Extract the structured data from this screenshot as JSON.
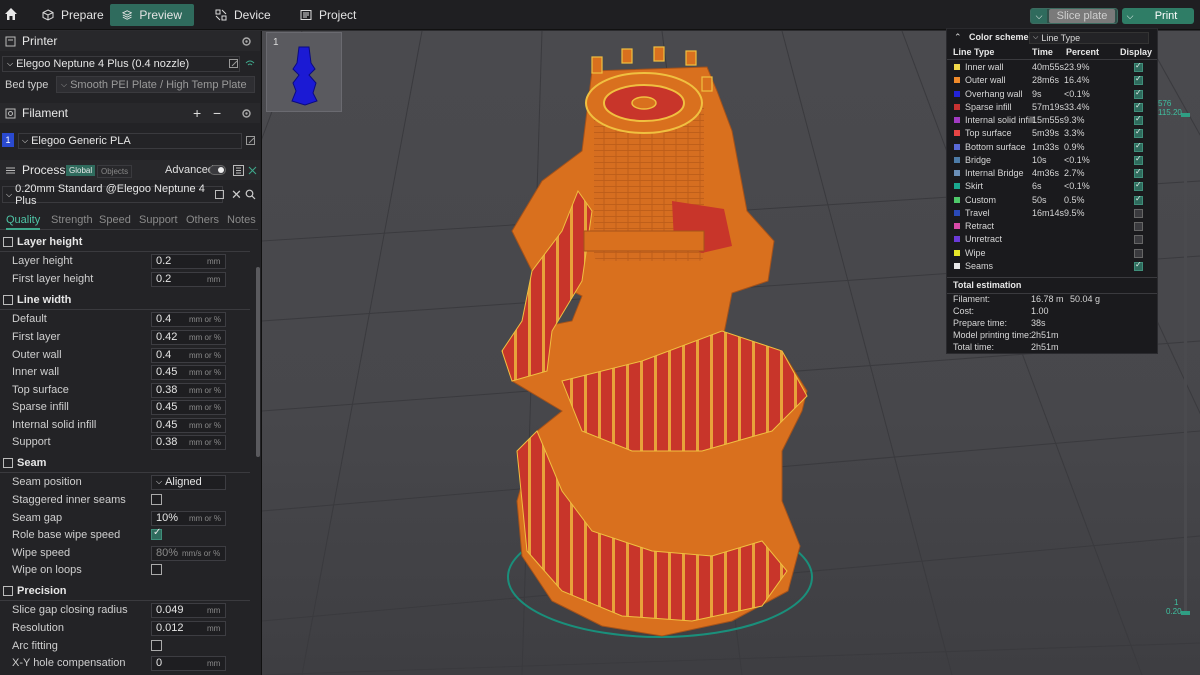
{
  "toolbar": {
    "prepare": "Prepare",
    "preview": "Preview",
    "device": "Device",
    "project": "Project",
    "slice_plate": "Slice plate",
    "print": "Print"
  },
  "printer": {
    "title": "Printer",
    "name": "Elegoo Neptune 4 Plus (0.4 nozzle)",
    "bed_type_label": "Bed type",
    "bed_type": "Smooth PEI Plate / High Temp Plate"
  },
  "filament": {
    "title": "Filament",
    "index": "1",
    "name": "Elegoo Generic PLA"
  },
  "process": {
    "title": "Process",
    "global": "Global",
    "objects": "Objects",
    "advanced": "Advanced",
    "preset": "0.20mm Standard @Elegoo Neptune 4 Plus",
    "tabs": [
      "Quality",
      "Strength",
      "Speed",
      "Support",
      "Others",
      "Notes"
    ]
  },
  "layer_height": {
    "title": "Layer height",
    "layer_height_label": "Layer height",
    "layer_height": "0.2",
    "unit": "mm",
    "first_label": "First layer height",
    "first": "0.2"
  },
  "line_width": {
    "title": "Line width",
    "unit": "mm or %",
    "items": [
      {
        "label": "Default",
        "value": "0.4"
      },
      {
        "label": "First layer",
        "value": "0.42"
      },
      {
        "label": "Outer wall",
        "value": "0.4"
      },
      {
        "label": "Inner wall",
        "value": "0.45"
      },
      {
        "label": "Top surface",
        "value": "0.38"
      },
      {
        "label": "Sparse infill",
        "value": "0.45"
      },
      {
        "label": "Internal solid infill",
        "value": "0.45"
      },
      {
        "label": "Support",
        "value": "0.38"
      }
    ]
  },
  "seam": {
    "title": "Seam",
    "position_label": "Seam position",
    "position": "Aligned",
    "staggered_label": "Staggered inner seams",
    "gap_label": "Seam gap",
    "gap": "10%",
    "gap_unit": "mm or %",
    "role_label": "Role base wipe speed",
    "wipe_speed_label": "Wipe speed",
    "wipe_speed": "80%",
    "wipe_unit": "mm/s or %",
    "wipe_loops_label": "Wipe on loops"
  },
  "precision": {
    "title": "Precision",
    "closing_label": "Slice gap closing radius",
    "closing": "0.049",
    "resolution_label": "Resolution",
    "resolution": "0.012",
    "arc_label": "Arc fitting",
    "xy_label": "X-Y hole compensation",
    "xy": "0",
    "unit": "mm"
  },
  "plate_thumb": {
    "index": "1"
  },
  "legend": {
    "title": "Color scheme",
    "scheme": "Line Type",
    "col_type": "Line Type",
    "col_time": "Time",
    "col_pct": "Percent",
    "col_display": "Display",
    "rows": [
      {
        "name": "Inner wall",
        "time": "40m55s",
        "pct": "23.9%",
        "color": "#f0d84a",
        "on": true
      },
      {
        "name": "Outer wall",
        "time": "28m6s",
        "pct": "16.4%",
        "color": "#f08a2a",
        "on": true
      },
      {
        "name": "Overhang wall",
        "time": "9s",
        "pct": "<0.1%",
        "color": "#2323d8",
        "on": true
      },
      {
        "name": "Sparse infill",
        "time": "57m19s",
        "pct": "33.4%",
        "color": "#c73232",
        "on": true
      },
      {
        "name": "Internal solid infill",
        "time": "15m55s",
        "pct": "9.3%",
        "color": "#a13ac2",
        "on": true
      },
      {
        "name": "Top surface",
        "time": "5m39s",
        "pct": "3.3%",
        "color": "#e84545",
        "on": true
      },
      {
        "name": "Bottom surface",
        "time": "1m33s",
        "pct": "0.9%",
        "color": "#5a6ad8",
        "on": true
      },
      {
        "name": "Bridge",
        "time": "10s",
        "pct": "<0.1%",
        "color": "#4d7ca8",
        "on": true
      },
      {
        "name": "Internal Bridge",
        "time": "4m36s",
        "pct": "2.7%",
        "color": "#6b8fb8",
        "on": true
      },
      {
        "name": "Skirt",
        "time": "6s",
        "pct": "<0.1%",
        "color": "#1aa88f",
        "on": true
      },
      {
        "name": "Custom",
        "time": "50s",
        "pct": "0.5%",
        "color": "#4ec96a",
        "on": true
      },
      {
        "name": "Travel",
        "time": "16m14s",
        "pct": "9.5%",
        "color": "#2a4ab8",
        "on": false
      },
      {
        "name": "Retract",
        "time": "",
        "pct": "",
        "color": "#d84aa8",
        "on": false
      },
      {
        "name": "Unretract",
        "time": "",
        "pct": "",
        "color": "#6a3ad8",
        "on": false
      },
      {
        "name": "Wipe",
        "time": "",
        "pct": "",
        "color": "#e8e82a",
        "on": false
      },
      {
        "name": "Seams",
        "time": "",
        "pct": "",
        "color": "#e8e8e8",
        "on": true
      }
    ],
    "est_title": "Total estimation",
    "filament_label": "Filament:",
    "filament_len": "16.78 m",
    "filament_weight": "50.04 g",
    "cost_label": "Cost:",
    "cost": "1.00",
    "prepare_label": "Prepare time:",
    "prepare": "38s",
    "model_label": "Model printing time:",
    "model": "2h51m",
    "total_label": "Total time:",
    "total": "2h51m"
  },
  "layer_slider": {
    "top_layer": "576",
    "top_height": "115.20",
    "bottom_layer": "1",
    "bottom_height": "0.20"
  },
  "colors": {
    "accent": "#2f6b5d",
    "model": "#d9701e"
  }
}
